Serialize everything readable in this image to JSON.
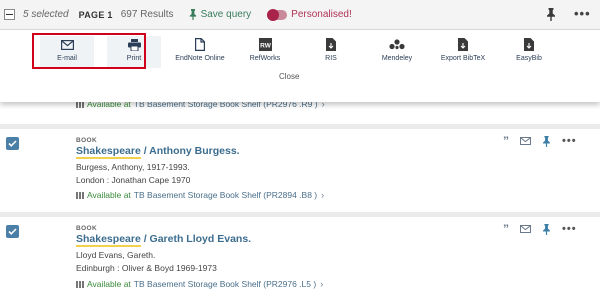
{
  "topbar": {
    "selected": "5 selected",
    "page": "PAGE 1",
    "results": "697 Results",
    "save_query": "Save query",
    "personalised": "Personalised!"
  },
  "export": {
    "items": [
      {
        "label": "E-mail",
        "icon": "envelope-icon"
      },
      {
        "label": "Print",
        "icon": "printer-icon"
      },
      {
        "label": "EndNote Online",
        "icon": "document-icon"
      },
      {
        "label": "RefWorks",
        "icon": "refworks-icon"
      },
      {
        "label": "RIS",
        "icon": "file-download-icon"
      },
      {
        "label": "Mendeley",
        "icon": "mendeley-icon"
      },
      {
        "label": "Export BibTeX",
        "icon": "file-download-icon"
      },
      {
        "label": "EasyBib",
        "icon": "file-download-icon"
      }
    ],
    "close": "Close",
    "highlight_color": "#d0021b"
  },
  "results": [
    {
      "available": "Available at",
      "location": "TB Basement Storage  Book Shelf (PR2976 .R9 )"
    },
    {
      "type": "BOOK",
      "title_highlight": "Shakespeare",
      "title_rest": " / Anthony Burgess.",
      "author": "Burgess, Anthony, 1917-1993.",
      "publication": "London : Jonathan Cape 1970",
      "available": "Available at",
      "location": "TB Basement Storage  Book Shelf (PR2894 .B8 )"
    },
    {
      "type": "BOOK",
      "title_highlight": "Shakespeare",
      "title_rest": " / Gareth Lloyd Evans.",
      "author": "Lloyd Evans, Gareth.",
      "publication": "Edinburgh : Oliver & Boyd 1969-1973",
      "available": "Available at",
      "location": "TB Basement Storage  Book Shelf (PR2976 .L5 )"
    }
  ],
  "colors": {
    "available": "#3a8a3a",
    "title": "#3c6d8f",
    "checkbox": "#4a7fa8",
    "pin": "#3a7d5c",
    "personalised": "#b03355"
  }
}
